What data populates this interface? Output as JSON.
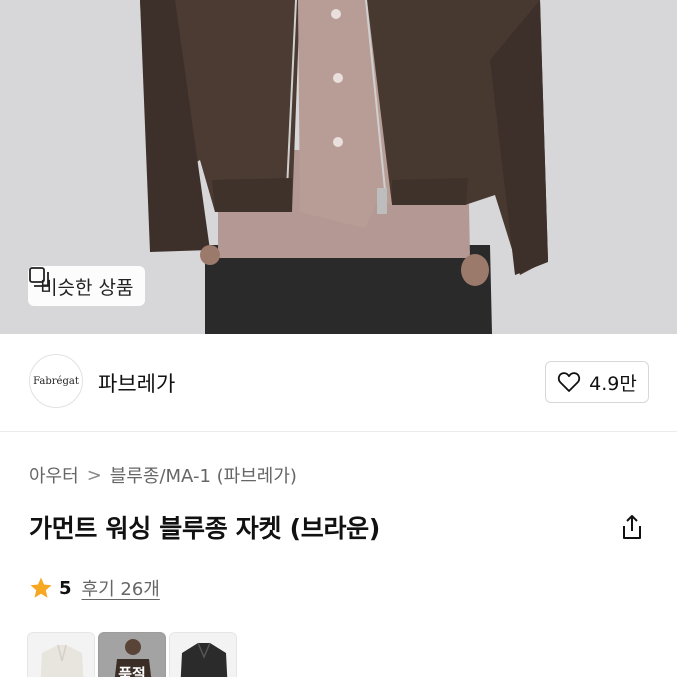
{
  "hero": {
    "similar_button_label": "비슷한 상품",
    "similar_icon": "similar-items-icon"
  },
  "brand": {
    "logo_text": "Fabrégat",
    "name": "파브레가",
    "like_icon": "heart-icon",
    "like_value": "4.9만"
  },
  "breadcrumb": {
    "items": [
      "아우터",
      "블루종/MA-1 (파브레가)"
    ],
    "separator": ">"
  },
  "product": {
    "title": "가먼트 워싱 블루종 자켓 (브라운)",
    "share_icon": "share-icon"
  },
  "rating": {
    "star_icon": "star-icon",
    "score": "5",
    "reviews": "후기 26개"
  },
  "thumbnails": [
    {
      "label": ""
    },
    {
      "label": "품절"
    },
    {
      "label": ""
    }
  ],
  "colors": {
    "star": "#f7a823",
    "jacket": "#4a3a31",
    "shirt": "#b59a95",
    "pants": "#2b2b2b",
    "background": "#d6d6d8"
  }
}
